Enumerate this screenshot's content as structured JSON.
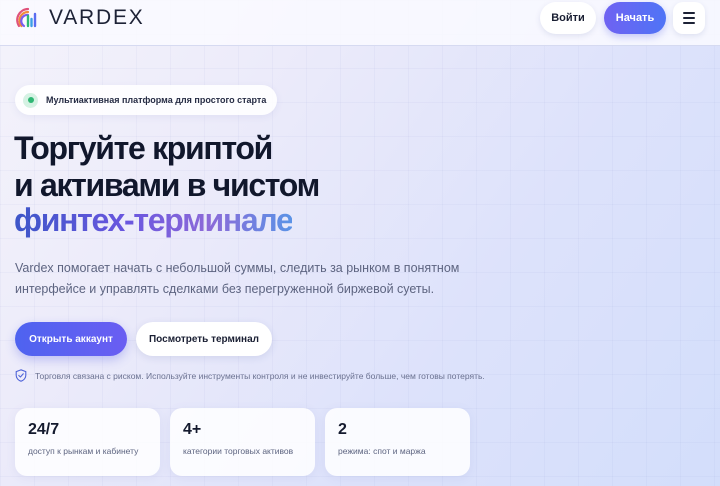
{
  "header": {
    "brand": "VARDEX",
    "login_label": "Войти",
    "start_label": "Начать"
  },
  "hero": {
    "badge": "Мультиактивная платформа для простого старта",
    "headline_line1": "Торгуйте криптой",
    "headline_line2": "и активами в чистом",
    "headline_accent": "финтех-терминале",
    "description": "Vardex помогает начать с небольшой суммы, следить за рынком в понятном интерфейсе и управлять сделками без перегруженной биржевой суеты.",
    "primary_cta": "Открыть аккаунт",
    "secondary_cta": "Посмотреть терминал",
    "risk_note": "Торговля связана с риском. Используйте инструменты контроля и не инвестируйте больше, чем готовы потерять."
  },
  "stats": [
    {
      "value": "24/7",
      "label": "доступ к рынкам и кабинету"
    },
    {
      "value": "4+",
      "label": "категории торговых активов"
    },
    {
      "value": "2",
      "label": "режима: спот и маржа"
    }
  ],
  "icons": {
    "logo": "vardex-logo-icon",
    "menu": "hamburger-menu-icon",
    "status": "status-dot-icon",
    "risk": "shield-check-icon"
  },
  "colors": {
    "accent_start": "#6f62f2",
    "accent_end": "#4f74f6",
    "status_green": "#2fb774",
    "text_dark": "#141a2e",
    "text_muted": "#5d6480"
  }
}
